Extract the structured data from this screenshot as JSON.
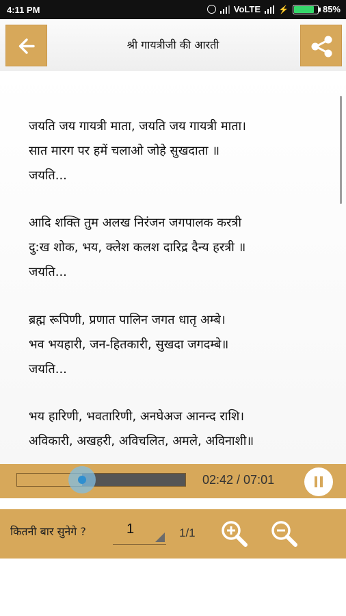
{
  "status_bar": {
    "time": "4:11 PM",
    "network": "VoLTE",
    "battery_text": "85%",
    "battery_level": 0.85,
    "battery_color": "#35d66a"
  },
  "header": {
    "title": "श्री गायत्रीजी की आरती",
    "back_icon": "arrow-left-icon",
    "share_icon": "share-icon"
  },
  "lyrics": [
    {
      "lines": [
        "जयति जय गायत्री माता, जयति जय गायत्री माता।",
        "सात मारग पर हमें चलाओ जोहे सुखदाता ॥",
        "जयति..."
      ]
    },
    {
      "lines": [
        "आदि शक्ति तुम अलख निरंजन जगपालक करत्री",
        "दु:ख शोक, भय, क्लेश कलश दारिद्र दैन्य हरत्री ॥",
        "जयति..."
      ]
    },
    {
      "lines": [
        "ब्रह्म रूपिणी, प्रणात पालिन जगत धातृ अम्बे।",
        "भव भयहारी, जन-हितकारी, सुखदा जगदम्बे॥",
        "जयति..."
      ]
    },
    {
      "lines": [
        "भय हारिणी, भवतारिणी, अनघेअज आनन्द राशि।",
        "अविकारी, अखहरी, अविचलित, अमले, अविनाशी॥"
      ]
    }
  ],
  "player": {
    "time_display": "02:42 / 07:01",
    "progress": 0.385,
    "state_icon": "pause-icon"
  },
  "controls": {
    "repeat_label": "कितनी बार सुनेगे ?",
    "repeat_value": "1",
    "repeat_counter": "1/1",
    "zoom_in_icon": "zoom-in-icon",
    "zoom_out_icon": "zoom-out-icon"
  },
  "colors": {
    "accent": "#d7a85a",
    "track": "#555555",
    "thumb": "#2f8fd0"
  }
}
